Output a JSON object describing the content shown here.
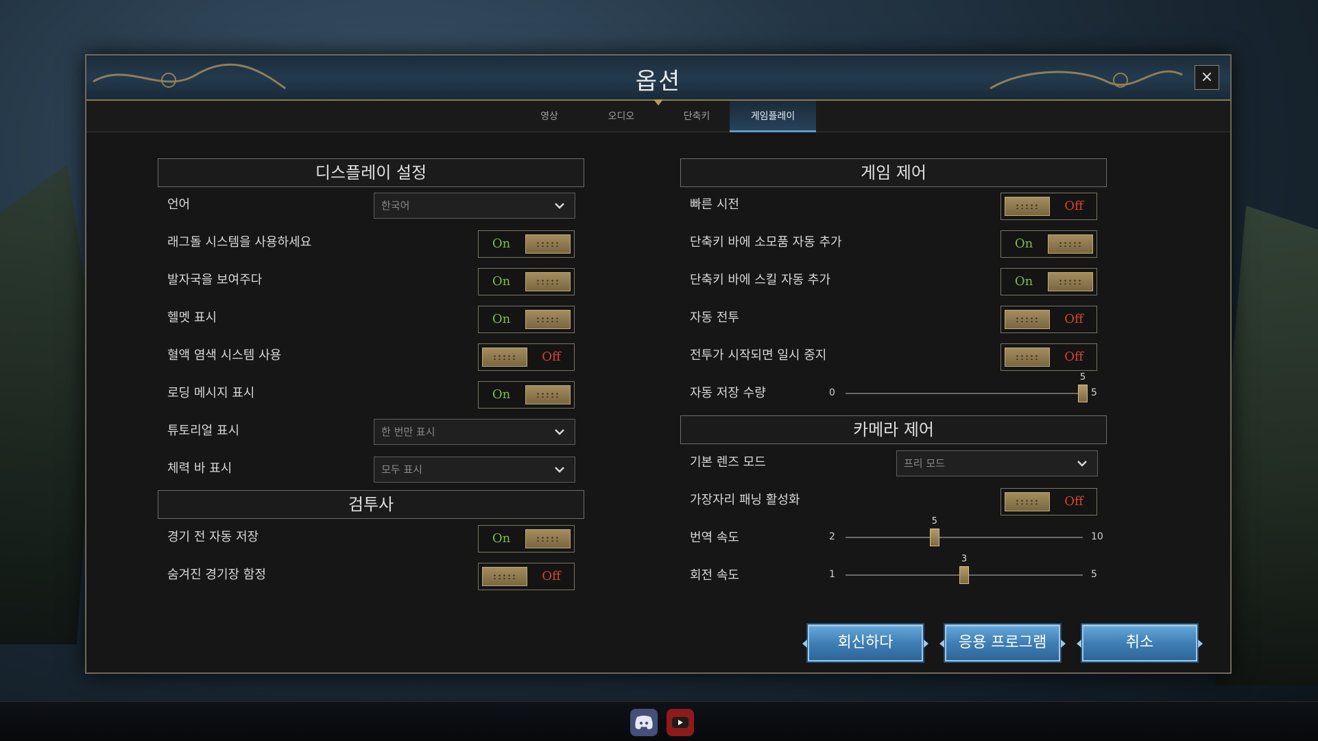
{
  "dialog": {
    "title": "옵션",
    "close_label": "×"
  },
  "tabs": [
    {
      "label": "영상",
      "active": false
    },
    {
      "label": "오디오",
      "active": false
    },
    {
      "label": "단축키",
      "active": false
    },
    {
      "label": "게임플레이",
      "active": true
    }
  ],
  "display": {
    "title": "디스플레이 설정",
    "language": {
      "label": "언어",
      "value": "한국어"
    },
    "ragdoll": {
      "label": "래그돌 시스템을 사용하세요",
      "state": "On"
    },
    "footprints": {
      "label": "발자국을 보여주다",
      "state": "On"
    },
    "helmet": {
      "label": "헬멧 표시",
      "state": "On"
    },
    "blood": {
      "label": "혈액 염색 시스템 사용",
      "state": "Off"
    },
    "loading_msg": {
      "label": "로딩 메시지 표시",
      "state": "On"
    },
    "tutorial": {
      "label": "튜토리얼 표시",
      "value": "한 번만 표시"
    },
    "health_bar": {
      "label": "체력 바 표시",
      "value": "모두 표시"
    }
  },
  "gladiator": {
    "title": "검투사",
    "autosave": {
      "label": "경기 전 자동 저장",
      "state": "On"
    },
    "traps": {
      "label": "숨겨진 경기장 함정",
      "state": "Off"
    }
  },
  "game_control": {
    "title": "게임 제어",
    "quick_look": {
      "label": "빠른 시전",
      "state": "Off"
    },
    "consumable": {
      "label": "단축키 바에 소모품 자동 추가",
      "state": "On"
    },
    "skill": {
      "label": "단축키 바에 스킬 자동 추가",
      "state": "On"
    },
    "auto_combat": {
      "label": "자동 전투",
      "state": "Off"
    },
    "pause_combat": {
      "label": "전투가 시작되면 일시 중지",
      "state": "Off"
    },
    "save_count": {
      "label": "자동 저장 수량",
      "min": "0",
      "max": "5",
      "value": "5",
      "fraction": 1.0
    }
  },
  "camera": {
    "title": "카메라 제어",
    "lens": {
      "label": "기본 렌즈 모드",
      "value": "프리 모드"
    },
    "edge_pan": {
      "label": "가장자리 패닝 활성화",
      "state": "Off"
    },
    "pan_speed": {
      "label": "번역 속도",
      "min": "2",
      "max": "10",
      "value": "5",
      "fraction": 0.375
    },
    "rotate_speed": {
      "label": "회전 속도",
      "min": "1",
      "max": "5",
      "value": "3",
      "fraction": 0.5
    }
  },
  "buttons": {
    "revert": "회신하다",
    "apply": "응용 프로그램",
    "cancel": "취소"
  },
  "icons": [
    "close-icon",
    "chevron-down-icon",
    "discord-icon",
    "youtube-icon"
  ]
}
